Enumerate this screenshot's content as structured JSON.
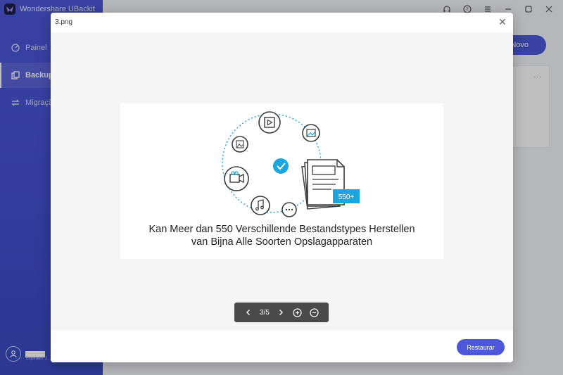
{
  "app": {
    "title": "Wondershare UBackit"
  },
  "sidebar": {
    "items": [
      {
        "label": "Painel",
        "icon": "dashboard-icon"
      },
      {
        "label": "Backup a",
        "icon": "backup-icon",
        "active": true
      },
      {
        "label": "Migraçã",
        "icon": "migration-icon"
      }
    ],
    "user": {
      "expiry": "Expirado: 2..."
    }
  },
  "window_controls": [
    "headset-icon",
    "help-icon",
    "menu-icon",
    "minimize-icon",
    "maximize-icon",
    "close-icon"
  ],
  "background": {
    "new_button_label": "Novo",
    "card_menu": "..."
  },
  "modal": {
    "title": "3.png",
    "caption_line1": "Kan Meer dan 550 Verschillende Bestandstypes Herstellen",
    "caption_line2": "van Bijna Alle Soorten Opslagapparaten",
    "badge": "550+",
    "pager": "3/5",
    "restore_label": "Restaurar"
  },
  "colors": {
    "accent": "#4c58d9",
    "illustration_blue": "#1aa7e0",
    "toolbar": "#4a4a4a"
  }
}
